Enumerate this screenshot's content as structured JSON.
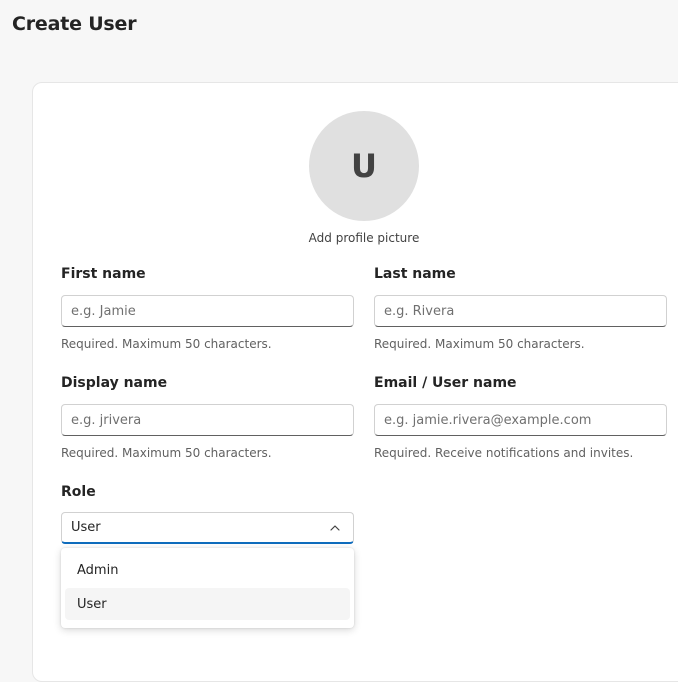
{
  "page": {
    "title": "Create User"
  },
  "avatar": {
    "initial": "U",
    "caption": "Add profile picture"
  },
  "fields": {
    "first_name": {
      "label": "First name",
      "value": "",
      "placeholder": "e.g. Jamie",
      "hint": "Required. Maximum 50 characters."
    },
    "last_name": {
      "label": "Last name",
      "value": "",
      "placeholder": "e.g. Rivera",
      "hint": "Required. Maximum 50 characters."
    },
    "display_name": {
      "label": "Display name",
      "value": "",
      "placeholder": "e.g. jrivera",
      "hint": "Required. Maximum 50 characters."
    },
    "email": {
      "label": "Email / User name",
      "value": "",
      "placeholder": "e.g. jamie.rivera@example.com",
      "hint": "Required. Receive notifications and invites."
    }
  },
  "role": {
    "label": "Role",
    "selected": "User",
    "expanded": true,
    "options": [
      "Admin",
      "User"
    ]
  },
  "icons": {
    "dropdown": "chevron-up-icon"
  },
  "colors": {
    "accent": "#0f6cbd",
    "selected_option_bg": "#f5f5f5",
    "avatar_bg": "#e0e0e0"
  }
}
